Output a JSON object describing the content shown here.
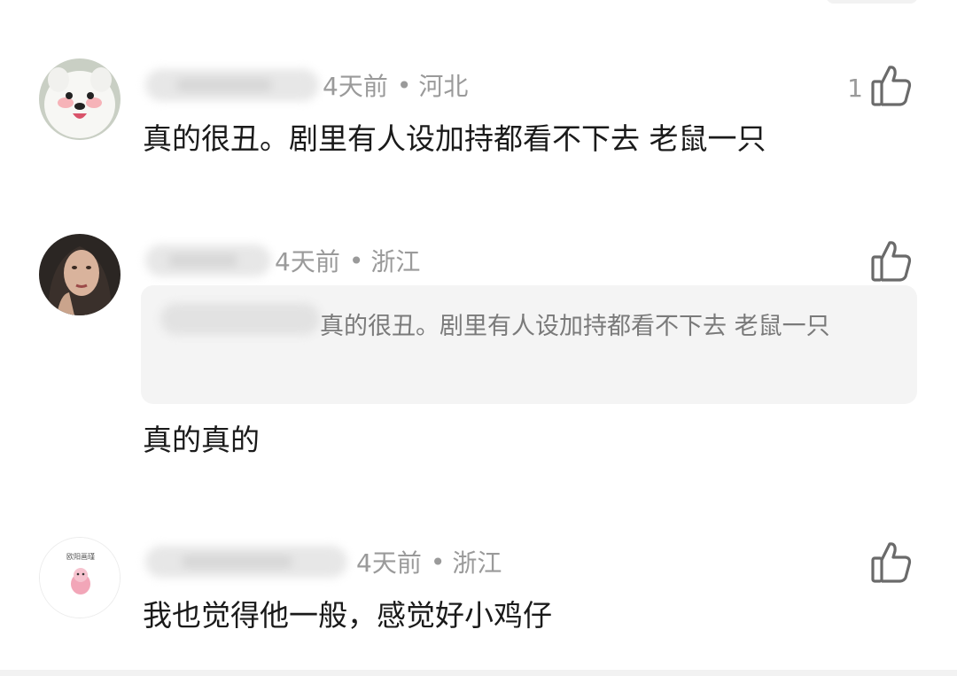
{
  "comments": [
    {
      "time": "4天前",
      "location": "河北",
      "likes": "1",
      "text": "真的很丑。剧里有人设加持都看不下去 老鼠一只"
    },
    {
      "time": "4天前",
      "location": "浙江",
      "likes": "",
      "quote": "真的很丑。剧里有人设加持都看不下去 老鼠一只",
      "text": "真的真的"
    },
    {
      "time": "4天前",
      "location": "浙江",
      "likes": "",
      "avatar_text": "欧阳画瑾",
      "text": "我也觉得他一般，感觉好小鸡仔"
    }
  ],
  "meta_separator": "•",
  "icons": {
    "like": "thumbs-up-icon"
  },
  "colors": {
    "meta_gray": "#9a9a9a",
    "quote_bg": "#f4f4f4",
    "text": "#1a1a1a"
  }
}
